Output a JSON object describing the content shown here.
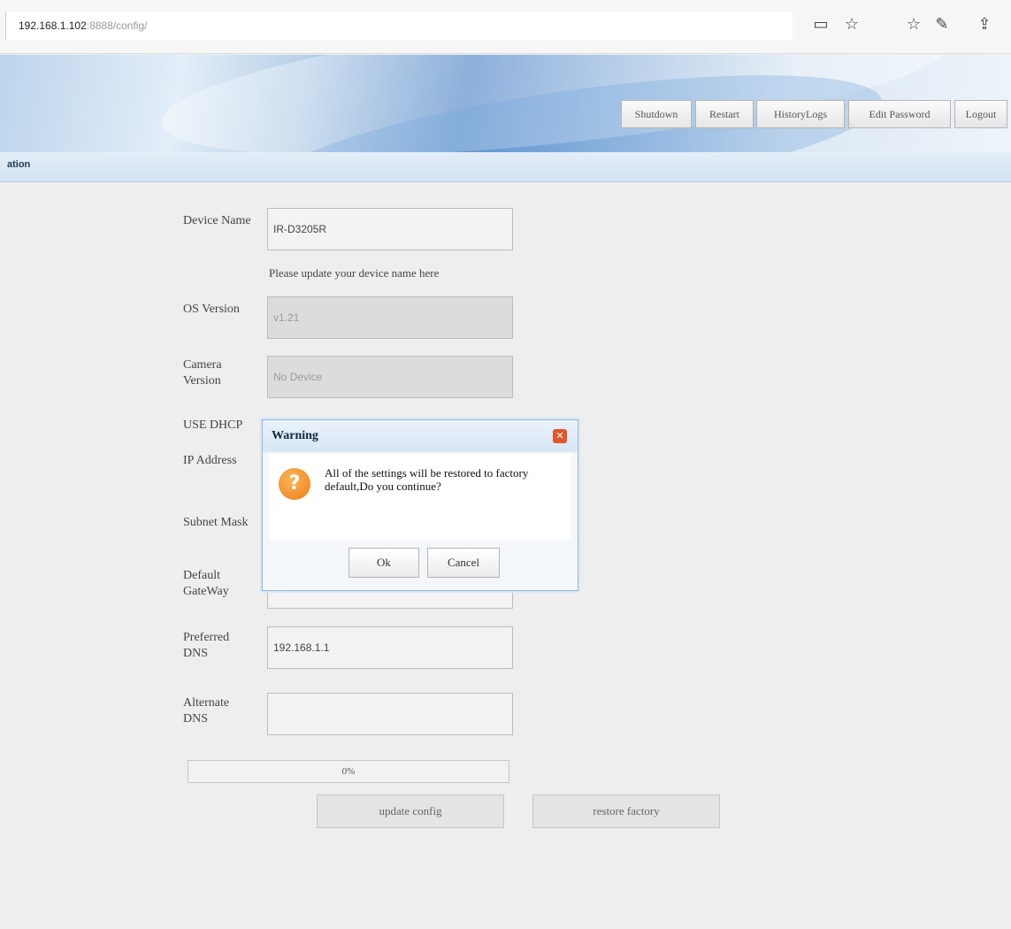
{
  "browser": {
    "url_host": "192.168.1.102",
    "url_rest": ":8888/config/",
    "icons": [
      "reading-view-icon",
      "favorite-star-icon",
      "favorites-icon",
      "pen-icon",
      "share-icon"
    ]
  },
  "header": {
    "buttons": [
      "Shutdown",
      "Restart",
      "HistoryLogs",
      "Edit Password",
      "Logout"
    ]
  },
  "nav": {
    "label": "ation"
  },
  "form": {
    "device_name_label": "Device Name",
    "device_name_value": "IR-D3205R",
    "device_name_hint": "Please update your device name here",
    "os_version_label": "OS Version",
    "os_version_value": "v1.21",
    "camera_version_label": "Camera Version",
    "camera_version_value": "No Device",
    "use_dhcp_label": "USE DHCP",
    "ip_address_label": "IP Address",
    "subnet_mask_label": "Subnet Mask",
    "default_gateway_label": "Default GateWay",
    "preferred_dns_label": "Preferred DNS",
    "preferred_dns_value": "192.168.1.1",
    "alternate_dns_label": "Alternate DNS",
    "alternate_dns_value": ""
  },
  "progress": {
    "text": "0%",
    "fraction": 0
  },
  "actions": {
    "update_label": "update config",
    "restore_label": "restore factory"
  },
  "dialog": {
    "title": "Warning",
    "message": "All of the settings will be restored to factory default,Do you continue?",
    "ok_label": "Ok",
    "cancel_label": "Cancel"
  },
  "colors": {
    "dialog_icon": "#ee7d16",
    "close_button": "#e0572c",
    "banner_accent": "#4f86c7"
  }
}
